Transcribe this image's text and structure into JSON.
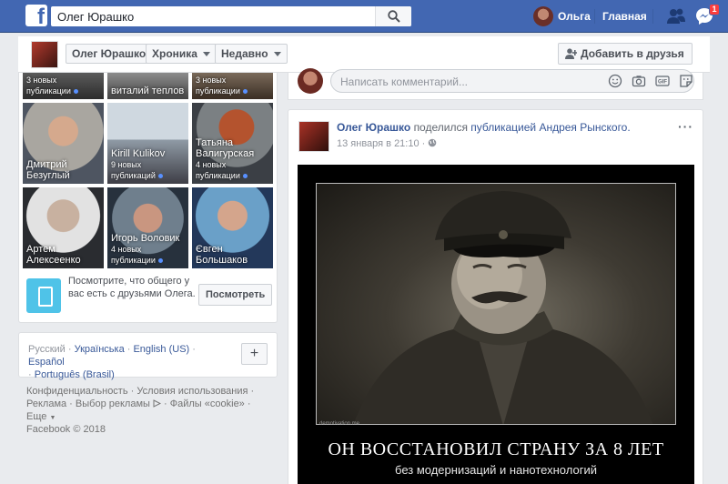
{
  "topbar": {
    "logo": "f",
    "search_value": "Олег Юрашко",
    "user_name": "Ольга",
    "home_label": "Главная",
    "notification_count": "1"
  },
  "profile_nav": {
    "name": "Олег Юрашко",
    "timeline_label": "Хроника",
    "recent_label": "Недавно",
    "add_friend_label": "Добавить в друзья"
  },
  "friends": {
    "top_row": [
      {
        "name": "",
        "sub": "3 новых публикации"
      },
      {
        "name": "виталий теплов",
        "sub": ""
      },
      {
        "name": "",
        "sub": "3 новых публикации"
      }
    ],
    "grid": [
      {
        "name": "Дмитрий Безуглый",
        "sub": ""
      },
      {
        "name": "Kirill Kulikov",
        "sub": "9 новых публикаций"
      },
      {
        "name": "Татьяна Валигурская",
        "sub": "4 новых публикации"
      },
      {
        "name": "Артем Алексеенко",
        "sub": ""
      },
      {
        "name": "Игорь Воловик",
        "sub": "4 новых публикации"
      },
      {
        "name": "Євген Большаков",
        "sub": ""
      }
    ],
    "suggest_text": "Посмотрите, что общего у вас есть с друзьями Олега.",
    "suggest_button": "Посмотреть"
  },
  "languages": {
    "current": "Русский",
    "others": [
      "Українська",
      "English (US)",
      "Español",
      "Português (Brasil)"
    ],
    "add_label": "+"
  },
  "footer": {
    "links": [
      "Конфиденциальность",
      "Условия использования",
      "Реклама",
      "Выбор рекламы",
      "Файлы «cookie»",
      "Еще"
    ],
    "copyright": "Facebook © 2018"
  },
  "comment_box": {
    "placeholder": "Написать комментарий..."
  },
  "post": {
    "author": "Олег Юрашко",
    "action": "поделился",
    "link_text": "публикацией Андрея Рынского.",
    "time": "13 января в 21:10",
    "more": "···",
    "watermark": "demotivation.me",
    "caption_big": "ОН ВОССТАНОВИЛ СТРАНУ ЗА 8 ЛЕТ",
    "caption_small": "без модернизаций и нанотехнологий"
  },
  "colors": {
    "topbar": "#4267b2",
    "link": "#385898",
    "badge": "#fa3e3e",
    "suggest_icon": "#4fc3e8"
  }
}
